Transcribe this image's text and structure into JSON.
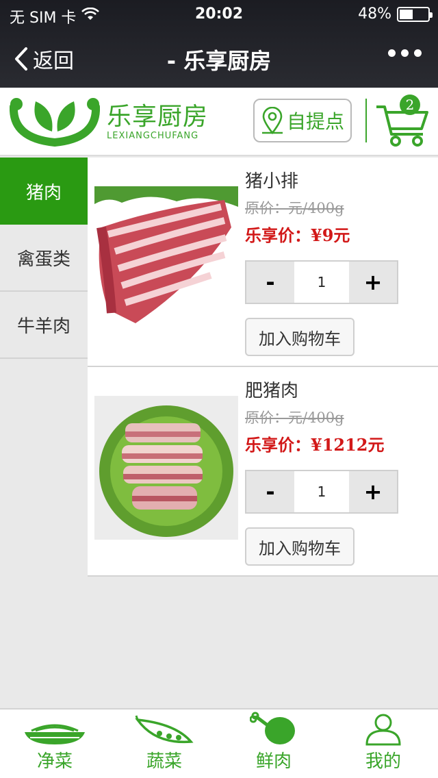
{
  "status_bar": {
    "carrier": "无 SIM 卡",
    "time": "20:02",
    "battery_percent": "48%",
    "battery_level": 0.48
  },
  "nav": {
    "back_label": "返回",
    "title": "- 乐享厨房"
  },
  "brand": {
    "name_cn": "乐享厨房",
    "name_en": "LEXIANGCHUFANG",
    "color": "#3aa52a"
  },
  "header": {
    "pickup_label": "自提点",
    "cart_count": "2"
  },
  "categories": [
    {
      "label": "猪肉",
      "active": true
    },
    {
      "label": "禽蛋类",
      "active": false
    },
    {
      "label": "牛羊肉",
      "active": false
    }
  ],
  "products": [
    {
      "name": "猪小排",
      "original_price": "原价：元/400g",
      "price": "乐享价：¥9元",
      "quantity": "1",
      "add_to_cart_label": "加入购物车",
      "image": "pork-ribs-photo"
    },
    {
      "name": "肥猪肉",
      "original_price": "原价：元/400g",
      "price": "乐享价：¥1212元",
      "quantity": "1",
      "add_to_cart_label": "加入购物车",
      "image": "pork-belly-photo"
    }
  ],
  "stepper": {
    "minus": "-",
    "plus": "+"
  },
  "tabbar": [
    {
      "label": "净菜",
      "icon": "noodle-bowl-icon"
    },
    {
      "label": "蔬菜",
      "icon": "pea-pod-icon"
    },
    {
      "label": "鲜肉",
      "icon": "drumstick-icon"
    },
    {
      "label": "我的",
      "icon": "user-icon"
    }
  ]
}
